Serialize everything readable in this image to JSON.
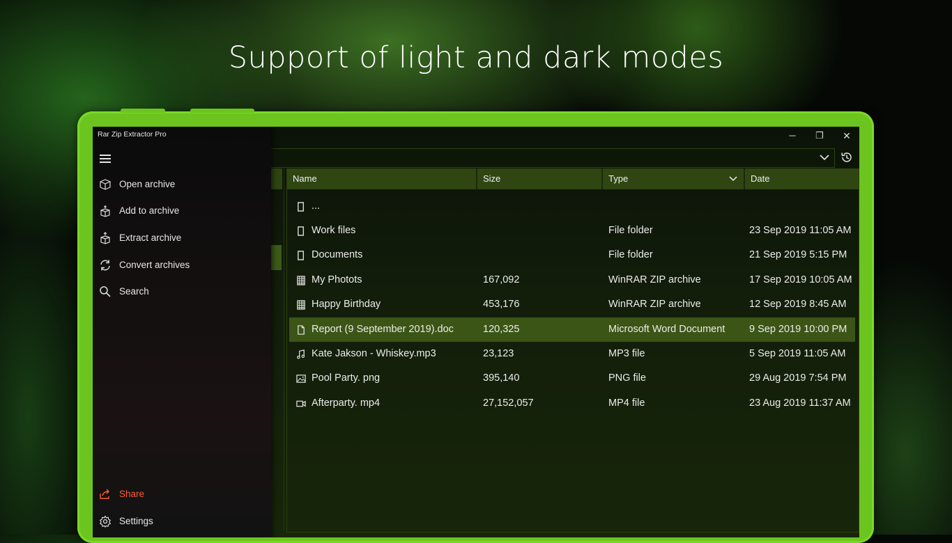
{
  "headline": "Support of light and dark modes",
  "colors": {
    "accent": "#6cc51f",
    "share": "#ff5b36",
    "selected_row": "#3b5516",
    "header": "#2f4612"
  },
  "app": {
    "title": "Rar Zip Extractor Pro"
  },
  "window_controls": {
    "minimize": "─",
    "restore": "❐",
    "close": "✕"
  },
  "sidebar": {
    "menu_icon": "hamburger-icon",
    "items": [
      {
        "label": "Open archive",
        "icon": "box-open-icon"
      },
      {
        "label": "Add to archive",
        "icon": "box-add-icon"
      },
      {
        "label": "Extract archive",
        "icon": "box-extract-icon"
      },
      {
        "label": "Convert archives",
        "icon": "refresh-icon"
      },
      {
        "label": "Search",
        "icon": "search-icon"
      }
    ],
    "footer": [
      {
        "label": "Share",
        "icon": "share-icon"
      },
      {
        "label": "Settings",
        "icon": "gear-icon"
      }
    ]
  },
  "table": {
    "columns": [
      "Name",
      "Size",
      "Type",
      "Date"
    ],
    "rows": [
      {
        "name": "...",
        "size": "",
        "type": "",
        "date": "",
        "icon": "file-icon"
      },
      {
        "name": "Work files",
        "size": "",
        "type": "File folder",
        "date": "23 Sep 2019 11:05 AM",
        "icon": "file-icon"
      },
      {
        "name": "Documents",
        "size": "",
        "type": "File folder",
        "date": "21 Sep 2019 5:15 PM",
        "icon": "file-icon"
      },
      {
        "name": "My Photots",
        "size": "167,092",
        "type": "WinRAR ZIP archive",
        "date": "17 Sep 2019 10:05 AM",
        "icon": "archive-icon"
      },
      {
        "name": "Happy Birthday",
        "size": "453,176",
        "type": "WinRAR ZIP archive",
        "date": "12 Sep 2019 8:45 AM",
        "icon": "archive-icon"
      },
      {
        "name": "Report (9 September 2019).doc",
        "size": "120,325",
        "type": "Microsoft Word Document",
        "date": "9 Sep 2019 10:00 PM",
        "icon": "document-icon",
        "selected": true
      },
      {
        "name": "Kate Jakson - Whiskey.mp3",
        "size": "23,123",
        "type": "MP3 file",
        "date": "5 Sep 2019 11:05 AM",
        "icon": "music-icon"
      },
      {
        "name": "Pool Party. png",
        "size": "395,140",
        "type": "PNG file",
        "date": "29 Aug 2019 7:54 PM",
        "icon": "image-icon"
      },
      {
        "name": "Afterparty. mp4",
        "size": "27,152,057",
        "type": "MP4 file",
        "date": "23 Aug 2019 11:37 AM",
        "icon": "video-icon"
      }
    ]
  }
}
